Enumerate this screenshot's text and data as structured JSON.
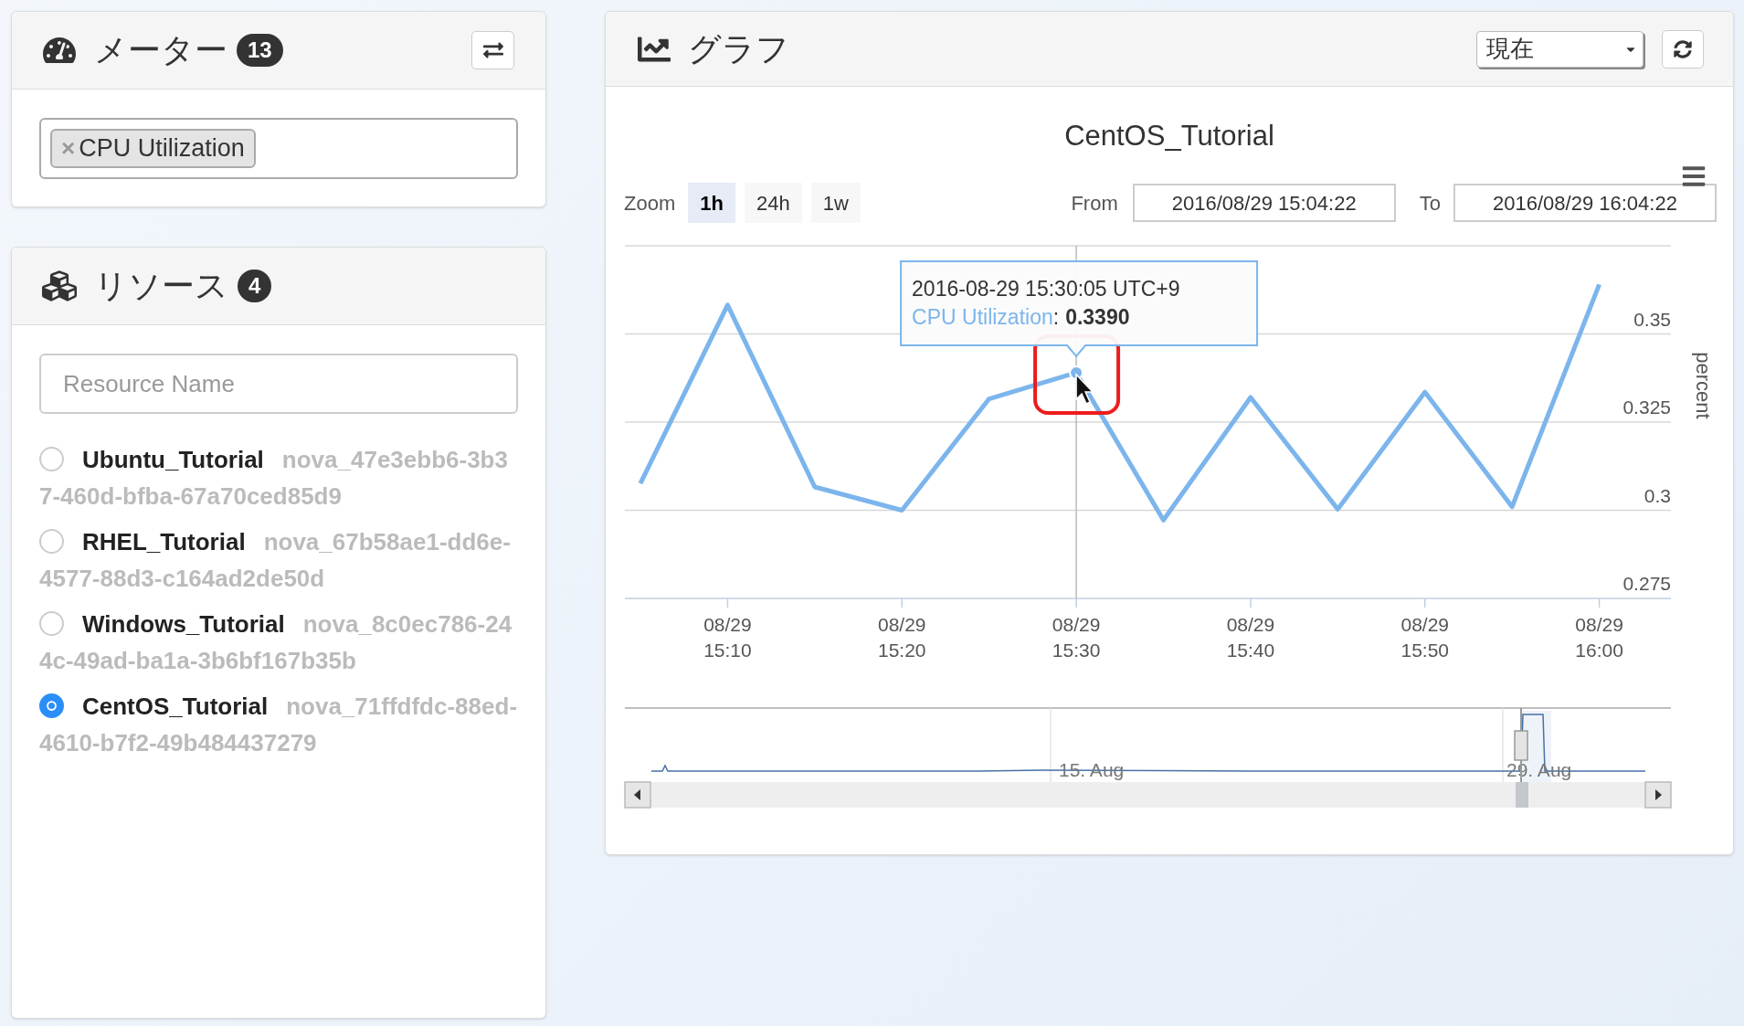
{
  "meters": {
    "title": "メーター",
    "count": "13",
    "tags": [
      {
        "remove": "×",
        "label": "CPU Utilization"
      }
    ]
  },
  "resources": {
    "title": "リソース",
    "count": "4",
    "search": {
      "placeholder": "Resource Name"
    },
    "items": [
      {
        "name": "Ubuntu_Tutorial",
        "id": "nova_47e3ebb6-3b37-460d-bfba-67a70ced85d9",
        "selected": false
      },
      {
        "name": "RHEL_Tutorial",
        "id": "nova_67b58ae1-dd6e-4577-88d3-c164ad2de50d",
        "selected": false
      },
      {
        "name": "Windows_Tutorial",
        "id": "nova_8c0ec786-244c-49ad-ba1a-3b6bf167b35b",
        "selected": false
      },
      {
        "name": "CentOS_Tutorial",
        "id": "nova_71ffdfdc-88ed-4610-b7f2-49b484437279",
        "selected": true
      }
    ]
  },
  "graph": {
    "title": "グラフ",
    "period": "現在",
    "chart": {
      "zoom_label": "Zoom",
      "zoom_buttons": [
        {
          "label": "1h",
          "selected": true
        },
        {
          "label": "24h",
          "selected": false
        },
        {
          "label": "1w",
          "selected": false
        }
      ],
      "from_label": "From",
      "from": "2016/08/29 15:04:22",
      "to_label": "To",
      "to": "2016/08/29 16:04:22",
      "tooltip": {
        "time": "2016-08-29 15:30:05 UTC+9",
        "separator": ":",
        "value": "0.3390"
      },
      "navigator": {
        "labels": [
          "15. Aug",
          "29. Aug"
        ]
      },
      "chart_data": {
        "type": "line",
        "title": "CentOS_Tutorial",
        "ylabel": "percent",
        "grid": true,
        "ylim": [
          0.275,
          0.375
        ],
        "categories": [
          null,
          "08/29 15:10",
          null,
          "08/29 15:20",
          null,
          "08/29 15:30",
          null,
          "08/29 15:40",
          null,
          "08/29 15:50",
          null,
          "08/29 16:00"
        ],
        "yticks": [
          {
            "value": 0.275,
            "label": "0.275"
          },
          {
            "value": 0.3,
            "label": "0.3"
          },
          {
            "value": 0.325,
            "label": "0.325"
          },
          {
            "value": 0.35,
            "label": "0.35"
          }
        ],
        "series": [
          {
            "name": "CPU Utilization",
            "color": "#7cb5ec",
            "values": [
              0.3076,
              0.3582,
              0.3066,
              0.3,
              0.3316,
              0.339,
              0.2972,
              0.332,
              0.3003,
              0.3335,
              0.301,
              0.364
            ]
          }
        ]
      }
    }
  }
}
